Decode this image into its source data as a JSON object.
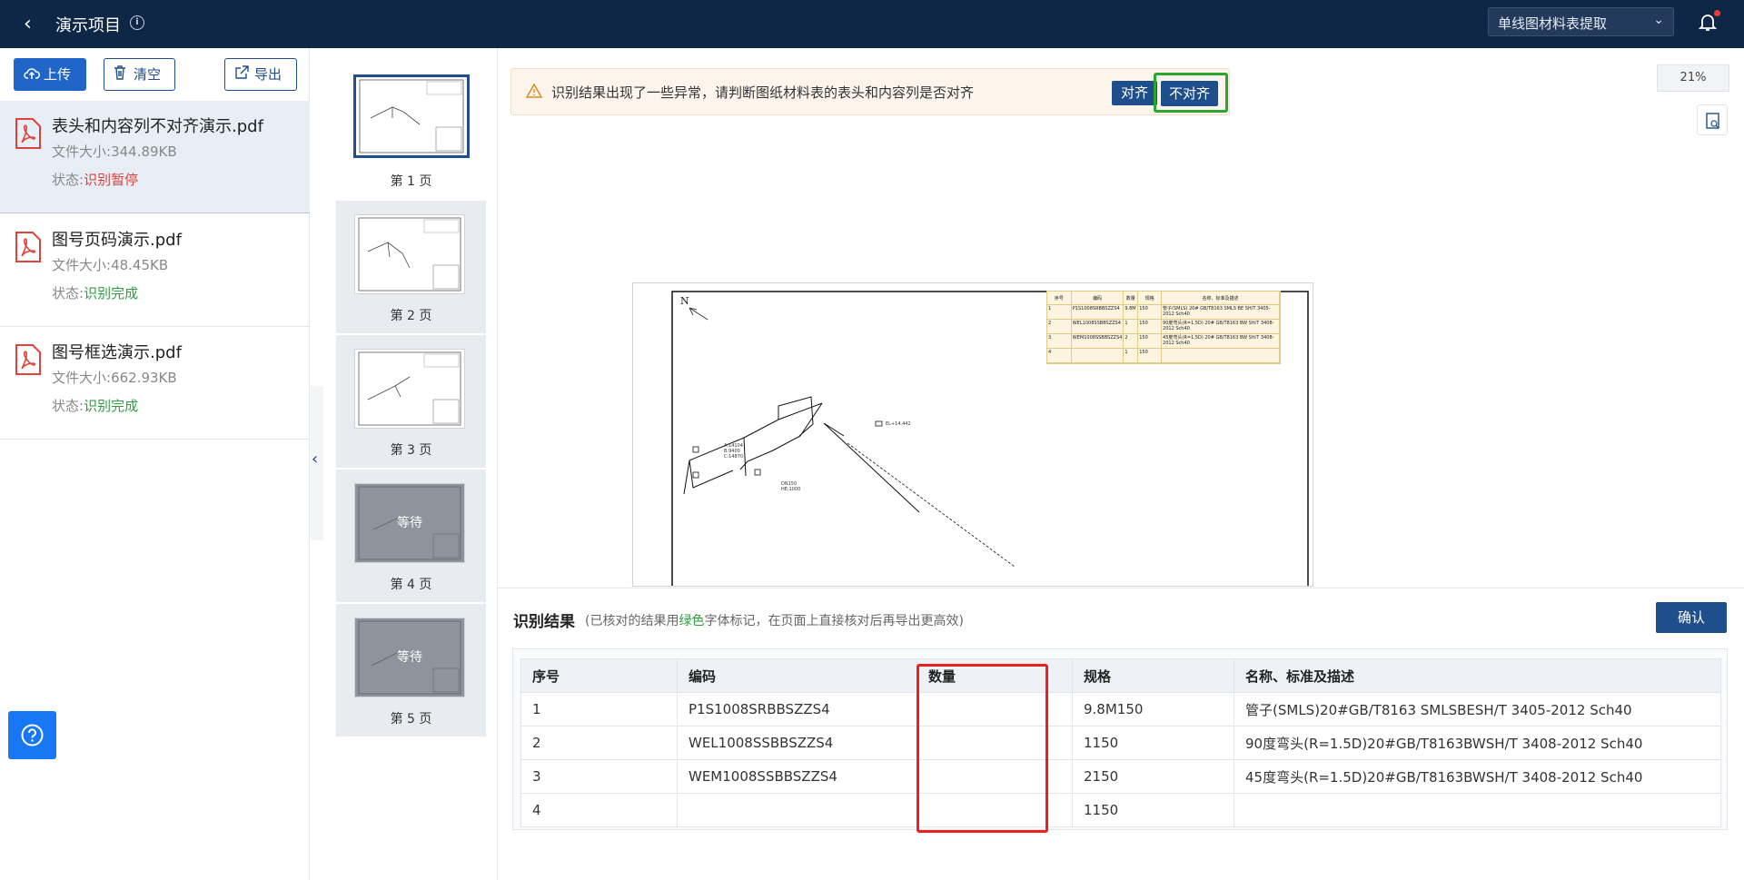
{
  "header": {
    "title": "演示项目",
    "mode_select": "单线图材料表提取"
  },
  "toolbar": {
    "upload_label": "上传",
    "clear_label": "清空",
    "export_label": "导出"
  },
  "files": [
    {
      "name": "表头和内容列不对齐演示.pdf",
      "size_label": "文件大小:",
      "size": "344.89KB",
      "status_label": "状态:",
      "status": "识别暂停"
    },
    {
      "name": "图号页码演示.pdf",
      "size_label": "文件大小:",
      "size": "48.45KB",
      "status_label": "状态:",
      "status": "识别完成"
    },
    {
      "name": "图号框选演示.pdf",
      "size_label": "文件大小:",
      "size": "662.93KB",
      "status_label": "状态:",
      "status": "识别完成"
    }
  ],
  "pages": [
    {
      "label": "第 1 页",
      "overlay": ""
    },
    {
      "label": "第 2 页",
      "overlay": ""
    },
    {
      "label": "第 3 页",
      "overlay": ""
    },
    {
      "label": "第 4 页",
      "overlay": "等待"
    },
    {
      "label": "第 5 页",
      "overlay": "等待"
    }
  ],
  "alert": {
    "message": "识别结果出现了一些异常，请判断图纸材料表的表头和内容列是否对齐",
    "align_label": "对齐",
    "not_align_label": "不对齐"
  },
  "viewer": {
    "zoom": "21%"
  },
  "drawing_table": {
    "headers": [
      "序号",
      "编码",
      "数量",
      "规格",
      "名称、标准及描述"
    ],
    "rows": [
      [
        "1",
        "P1S1008SRBBSZZS4",
        "9.8M",
        "150",
        "管子(SMLS) 20# GB/T8163 SMLS BE SH/T 3405-2012 Sch40"
      ],
      [
        "2",
        "WEL1008SSBBSZZS4",
        "1",
        "150",
        "90度弯头(R=1.5D) 20# GB/T8163 BW SH/T 3408-2012 Sch40"
      ],
      [
        "3",
        "WEM1008SSBBSZZS4",
        "2",
        "150",
        "45度弯头(R=1.5D) 20# GB/T8163 BW SH/T 3408-2012 Sch40"
      ],
      [
        "4",
        "",
        "1",
        "150",
        ""
      ]
    ]
  },
  "results": {
    "title": "识别结果",
    "note_prefix": "(已核对的结果用",
    "note_green": "绿色",
    "note_suffix": "字体标记，在页面上直接核对后再导出更高效)",
    "confirm_label": "确认",
    "columns": [
      "序号",
      "编码",
      "数量",
      "规格",
      "名称、标准及描述"
    ],
    "rows": [
      [
        "1",
        "P1S1008SRBBSZZS4",
        "",
        "9.8M150",
        "管子(SMLS)20#GB/T8163 SMLSBESH/T 3405-2012 Sch40"
      ],
      [
        "2",
        "WEL1008SSBBSZZS4",
        "",
        "1150",
        "90度弯头(R=1.5D)20#GB/T8163BWSH/T 3408-2012 Sch40"
      ],
      [
        "3",
        "WEM1008SSBBSZZS4",
        "",
        "2150",
        "45度弯头(R=1.5D)20#GB/T8163BWSH/T 3408-2012 Sch40"
      ],
      [
        "4",
        "",
        "",
        "1150",
        ""
      ]
    ]
  },
  "colors": {
    "header_bg": "#0f2747",
    "primary": "#1f4e8c",
    "status_paused": "#e0413b",
    "status_done": "#2f9e40",
    "highlight_green": "#2aa52e",
    "highlight_red": "#e8231f"
  }
}
